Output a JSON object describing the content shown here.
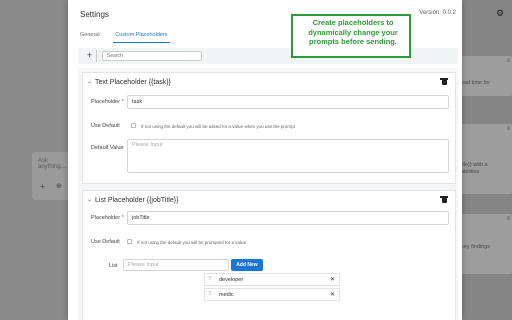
{
  "background": {
    "input_placeholder": "Ask anything...",
    "cards": [
      {
        "text": "ead time for"
      },
      {
        "text": "itle}} with a\nabilities"
      },
      {
        "text": "key findings"
      }
    ]
  },
  "dialog": {
    "title": "Settings",
    "version": "Version: 0.0.2",
    "tabs": [
      {
        "label": "General",
        "active": false
      },
      {
        "label": "Custom Placeholders",
        "active": true
      }
    ],
    "toolbar": {
      "add_label": "+",
      "search_placeholder": "Search"
    },
    "placeholders": [
      {
        "header": "Text Placeholder {{task}}",
        "placeholder_label": "Placeholder",
        "placeholder_value": "task",
        "use_default_label": "Use Default",
        "use_default_hint": "If not using the default you will be asked for a value when you use the prompt",
        "default_value_label": "Default Value",
        "default_value_placeholder": "Please Input"
      },
      {
        "header": "List Placeholder {{jobTitle}}",
        "placeholder_label": "Placeholder",
        "placeholder_value": "jobTitle",
        "use_default_label": "Use Default",
        "use_default_hint": "If not using the default you will be prompted for a value",
        "list_label": "List",
        "list_input_placeholder": "Please Input",
        "add_new_label": "Add New",
        "items": [
          "developer",
          "medic"
        ]
      }
    ]
  },
  "callout": {
    "text": "Create placeholders to dynamically change your prompts before sending.",
    "color": "#2e9a3a"
  },
  "colors": {
    "accent": "#1976d2",
    "required": "#d32f2f"
  }
}
